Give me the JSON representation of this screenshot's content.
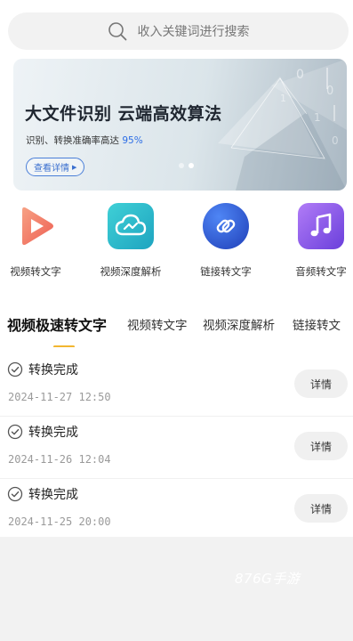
{
  "search": {
    "placeholder": "收入关键词进行搜索",
    "icon": "search-icon"
  },
  "banner": {
    "title": "大文件识别 云端高效算法",
    "subtitle_prefix": "识别、转换准确率高达",
    "subtitle_highlight": "95%",
    "cta_label": "查看详情",
    "slides": 2,
    "active_slide": 0
  },
  "functions": [
    {
      "label": "视频转文字",
      "icon": "video-play-icon",
      "color": "#f07a5a"
    },
    {
      "label": "视频深度解析",
      "icon": "cloud-icon",
      "color": "#2bb8c7"
    },
    {
      "label": "链接转文字",
      "icon": "link-icon",
      "color": "#2f5fd6"
    },
    {
      "label": "音频转文字",
      "icon": "music-note-icon",
      "color": "#8a56e6"
    }
  ],
  "tabs": [
    "视频极速转文字",
    "视频转文字",
    "视频深度解析",
    "链接转文"
  ],
  "active_tab": 0,
  "records": [
    {
      "status": "转换完成",
      "time": "2024-11-27 12:50",
      "button": "详情"
    },
    {
      "status": "转换完成",
      "time": "2024-11-26 12:04",
      "button": "详情"
    },
    {
      "status": "转换完成",
      "time": "2024-11-25 20:00",
      "button": "详情"
    }
  ],
  "watermark": "876G手游",
  "colors": {
    "accent": "#f2b630",
    "highlight": "#2d6ee6",
    "muted": "#9a9a9a"
  }
}
